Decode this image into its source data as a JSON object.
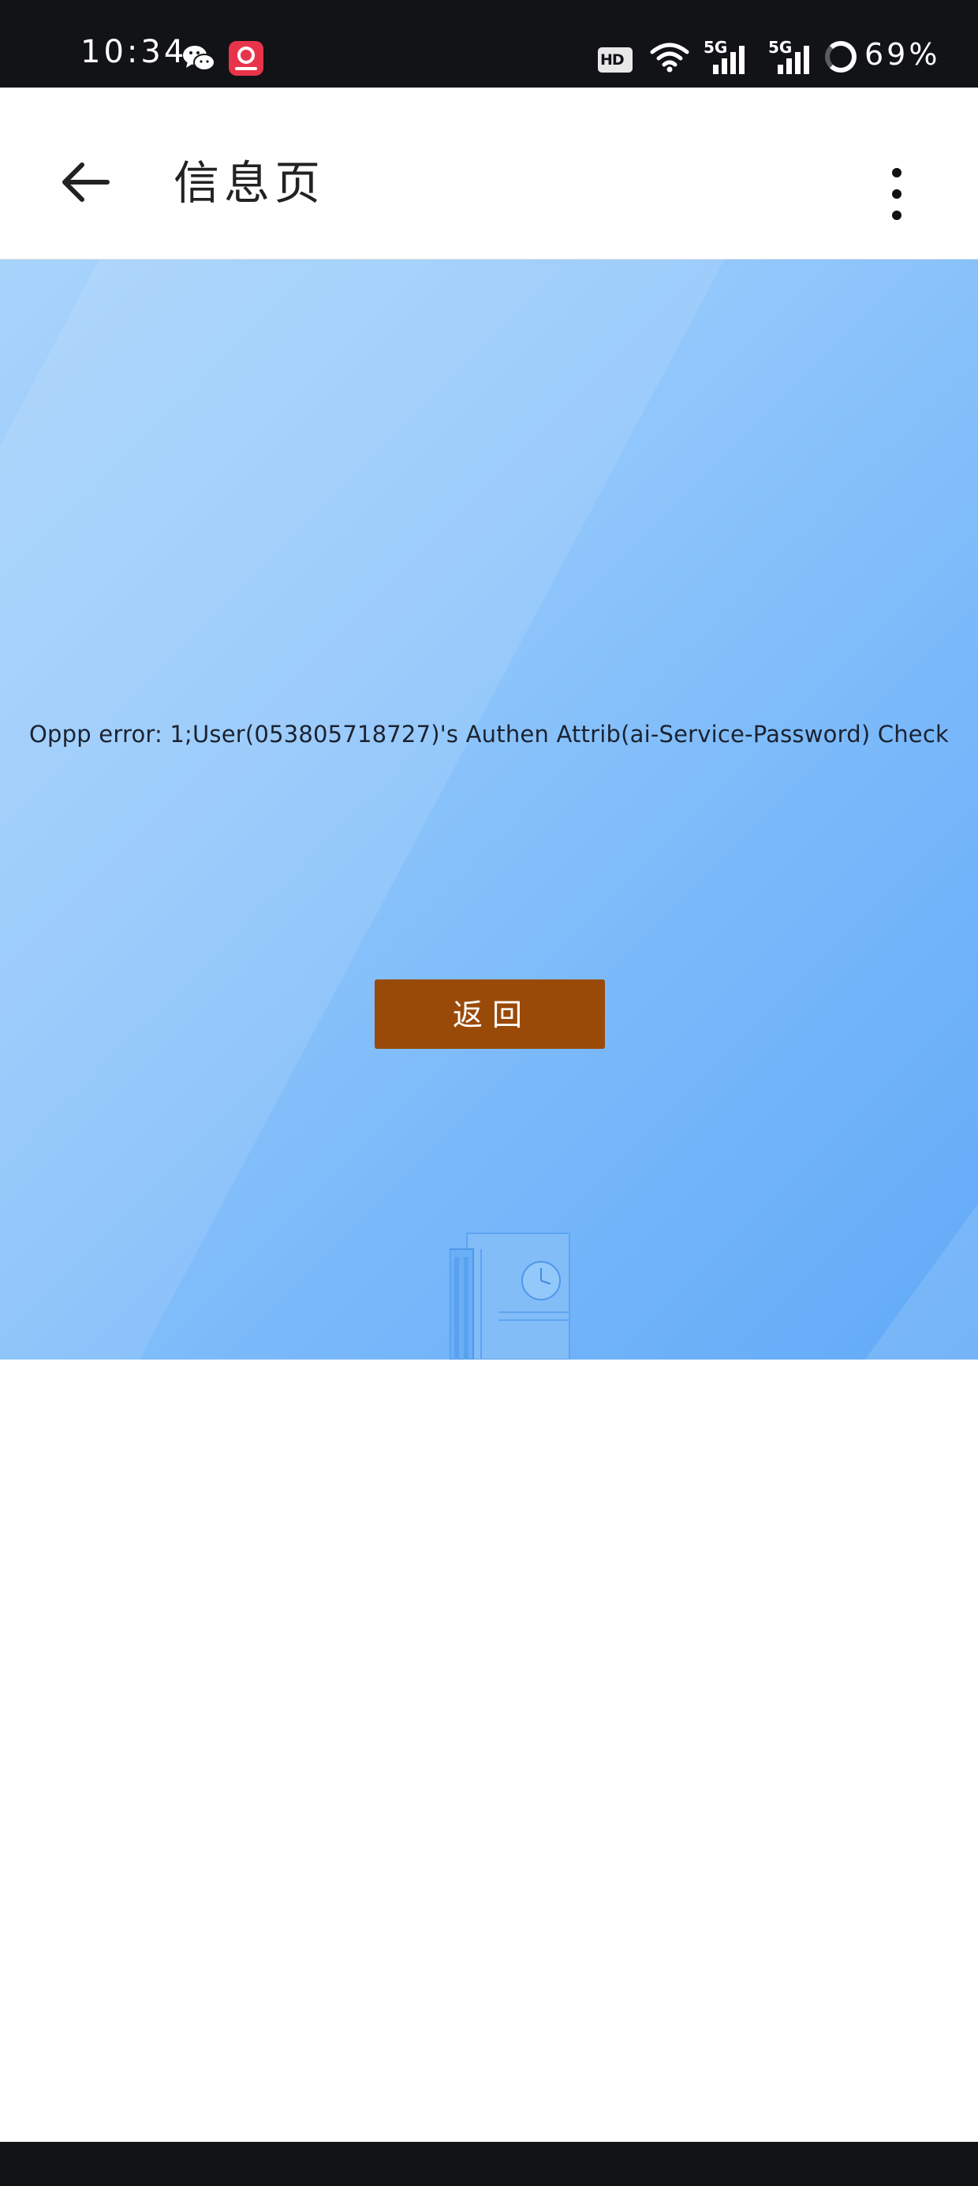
{
  "status_bar": {
    "time": "10:34",
    "icons": [
      "wechat-icon",
      "app-notification-icon",
      "hd-icon",
      "wifi-icon",
      "5g-signal-icon",
      "5g-signal-icon",
      "battery-ring-icon"
    ],
    "hd_label": "HD",
    "network_1": "5G",
    "network_2": "5G",
    "battery": "69%"
  },
  "app_bar": {
    "back_icon": "arrow-left-icon",
    "title": "信息页",
    "menu_icon": "more-vertical-icon"
  },
  "main": {
    "error_message": "Oppp error: 1;User(053805718727)'s Authen Attrib(ai-Service-Password) Check",
    "return_button": "返回"
  },
  "colors": {
    "status_bar_bg": "#121317",
    "hero_gradient_start": "#a8d3fb",
    "hero_gradient_end": "#62aaf7",
    "button_bg": "#9a4a08",
    "button_text": "#ffffff"
  }
}
